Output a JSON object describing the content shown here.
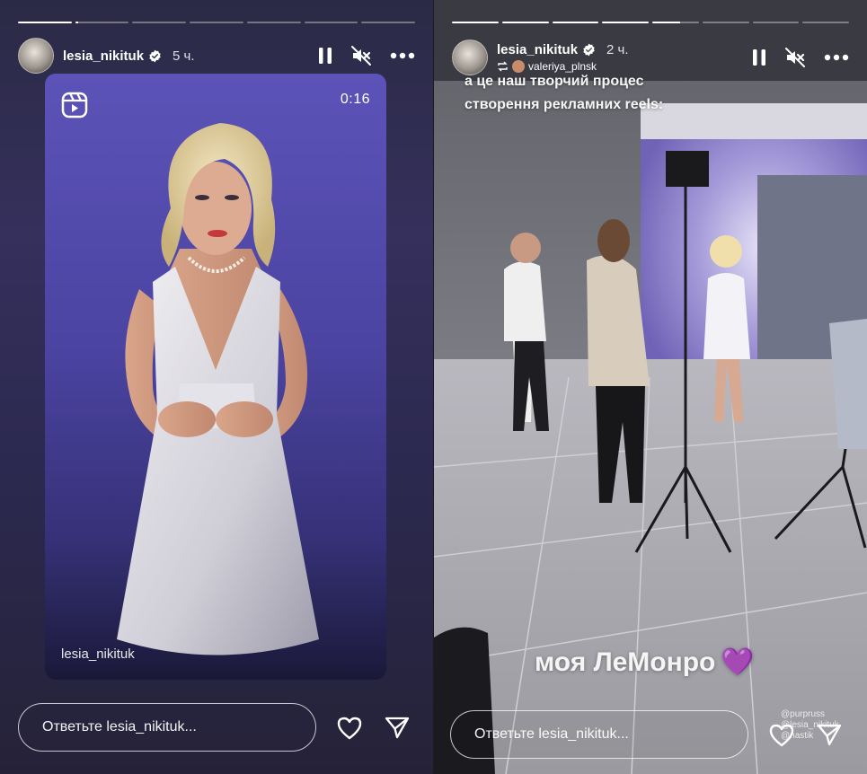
{
  "stories": [
    {
      "username": "lesia_nikituk",
      "time": "5 ч.",
      "progress": [
        1,
        0.05,
        0,
        0,
        0,
        0,
        0
      ],
      "reel": {
        "duration": "0:16",
        "caption": "lesia_nikituk"
      },
      "reply_placeholder": "Ответьте lesia_nikituk..."
    },
    {
      "username": "lesia_nikituk",
      "time": "2 ч.",
      "reposted_from": "valeriya_plnsk",
      "progress": [
        1,
        1,
        1,
        1,
        0.6,
        0,
        0,
        0
      ],
      "overlay_lines": [
        "а це наш творчий процес",
        "створення рекламних reels:"
      ],
      "sticker_text": "моя ЛеМонро",
      "sticker_emoji": "💜",
      "mention_tags": [
        "@purpruss",
        "@lesia_nikituk",
        "@nastik"
      ],
      "reply_placeholder": "Ответьте lesia_nikituk..."
    }
  ],
  "colors": {
    "accent_white": "#ffffff",
    "verified_blue": "#ffffff",
    "story_bg_left": "#2c2950",
    "reel_bg": "#4b44a2"
  }
}
